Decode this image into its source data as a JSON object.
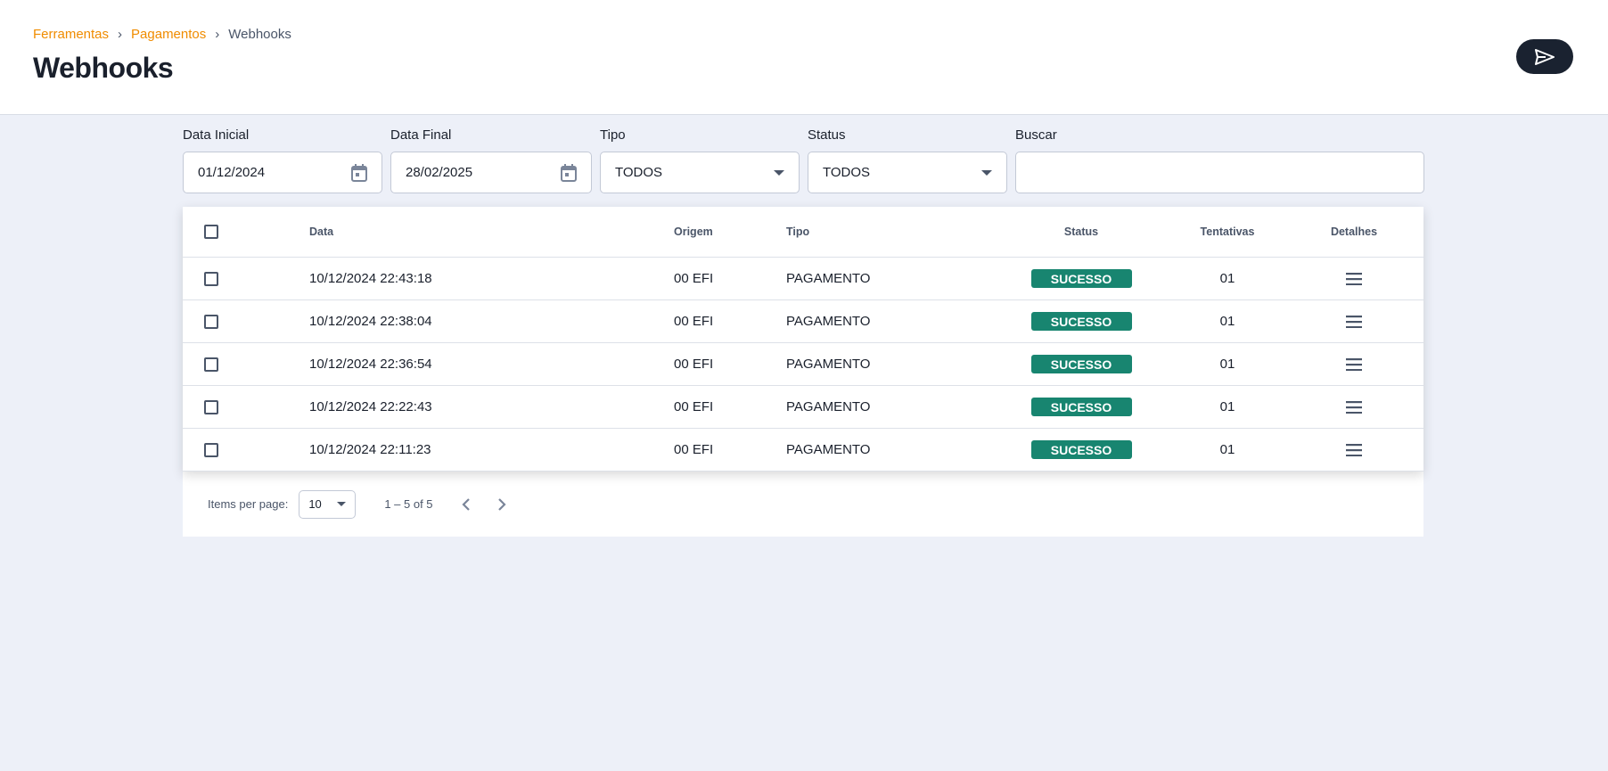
{
  "breadcrumb": {
    "items": [
      "Ferramentas",
      "Pagamentos"
    ],
    "current": "Webhooks"
  },
  "page_title": "Webhooks",
  "filters": {
    "data_inicial": {
      "label": "Data Inicial",
      "value": "01/12/2024"
    },
    "data_final": {
      "label": "Data Final",
      "value": "28/02/2025"
    },
    "tipo": {
      "label": "Tipo",
      "value": "TODOS"
    },
    "status": {
      "label": "Status",
      "value": "TODOS"
    },
    "buscar": {
      "label": "Buscar",
      "value": ""
    }
  },
  "table": {
    "headers": [
      "Data",
      "Origem",
      "Tipo",
      "Status",
      "Tentativas",
      "Detalhes"
    ],
    "rows": [
      {
        "data": "10/12/2024 22:43:18",
        "origem": "00 EFI",
        "tipo": "PAGAMENTO",
        "status": "SUCESSO",
        "tentativas": "01"
      },
      {
        "data": "10/12/2024 22:38:04",
        "origem": "00 EFI",
        "tipo": "PAGAMENTO",
        "status": "SUCESSO",
        "tentativas": "01"
      },
      {
        "data": "10/12/2024 22:36:54",
        "origem": "00 EFI",
        "tipo": "PAGAMENTO",
        "status": "SUCESSO",
        "tentativas": "01"
      },
      {
        "data": "10/12/2024 22:22:43",
        "origem": "00 EFI",
        "tipo": "PAGAMENTO",
        "status": "SUCESSO",
        "tentativas": "01"
      },
      {
        "data": "10/12/2024 22:11:23",
        "origem": "00 EFI",
        "tipo": "PAGAMENTO",
        "status": "SUCESSO",
        "tentativas": "01"
      }
    ]
  },
  "paginator": {
    "items_per_page_label": "Items per page:",
    "page_size": "10",
    "range": "1 – 5 of 5"
  },
  "colors": {
    "accent": "#f08c00",
    "success": "#188570",
    "dark": "#1a2230"
  }
}
